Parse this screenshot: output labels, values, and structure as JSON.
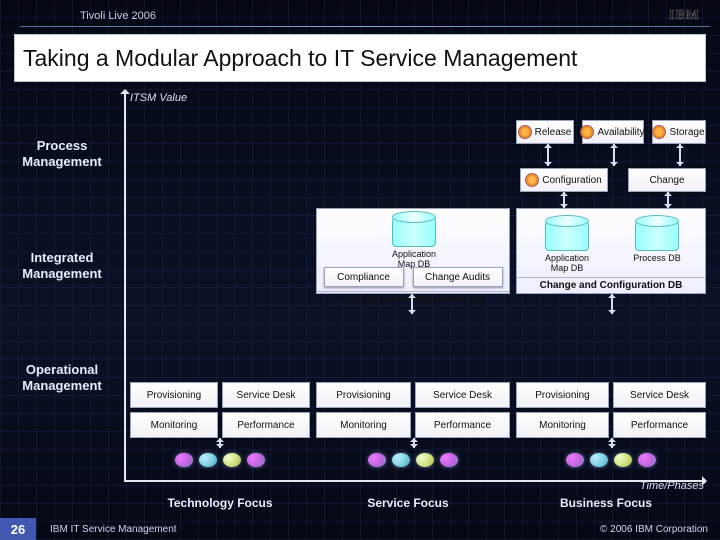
{
  "header": {
    "event": "Tivoli Live 2006",
    "logo": "IBM"
  },
  "title": "Taking a Modular Approach to IT Service Management",
  "axes": {
    "y": "ITSM Value",
    "x": "Time/Phases"
  },
  "rows": {
    "process": "Process\nManagement",
    "integrated": "Integrated\nManagement",
    "operational": "Operational\nManagement"
  },
  "process_boxes": {
    "release": "Release",
    "availability": "Availability",
    "storage": "Storage",
    "configuration": "Configuration",
    "change": "Change"
  },
  "integrated": {
    "app_map_db": "Application\nMap DB",
    "process_db": "Process DB",
    "compliance": "Compliance",
    "change_audits": "Change Audits",
    "ccdb": "Change and Configuration DB"
  },
  "op_boxes": {
    "provisioning": "Provisioning",
    "service_desk": "Service Desk",
    "monitoring": "Monitoring",
    "performance": "Performance"
  },
  "phases": {
    "tech": "Technology Focus",
    "service": "Service Focus",
    "business": "Business Focus"
  },
  "footer": {
    "page": "26",
    "left": "IBM IT Service Management",
    "right": "© 2006 IBM Corporation"
  }
}
